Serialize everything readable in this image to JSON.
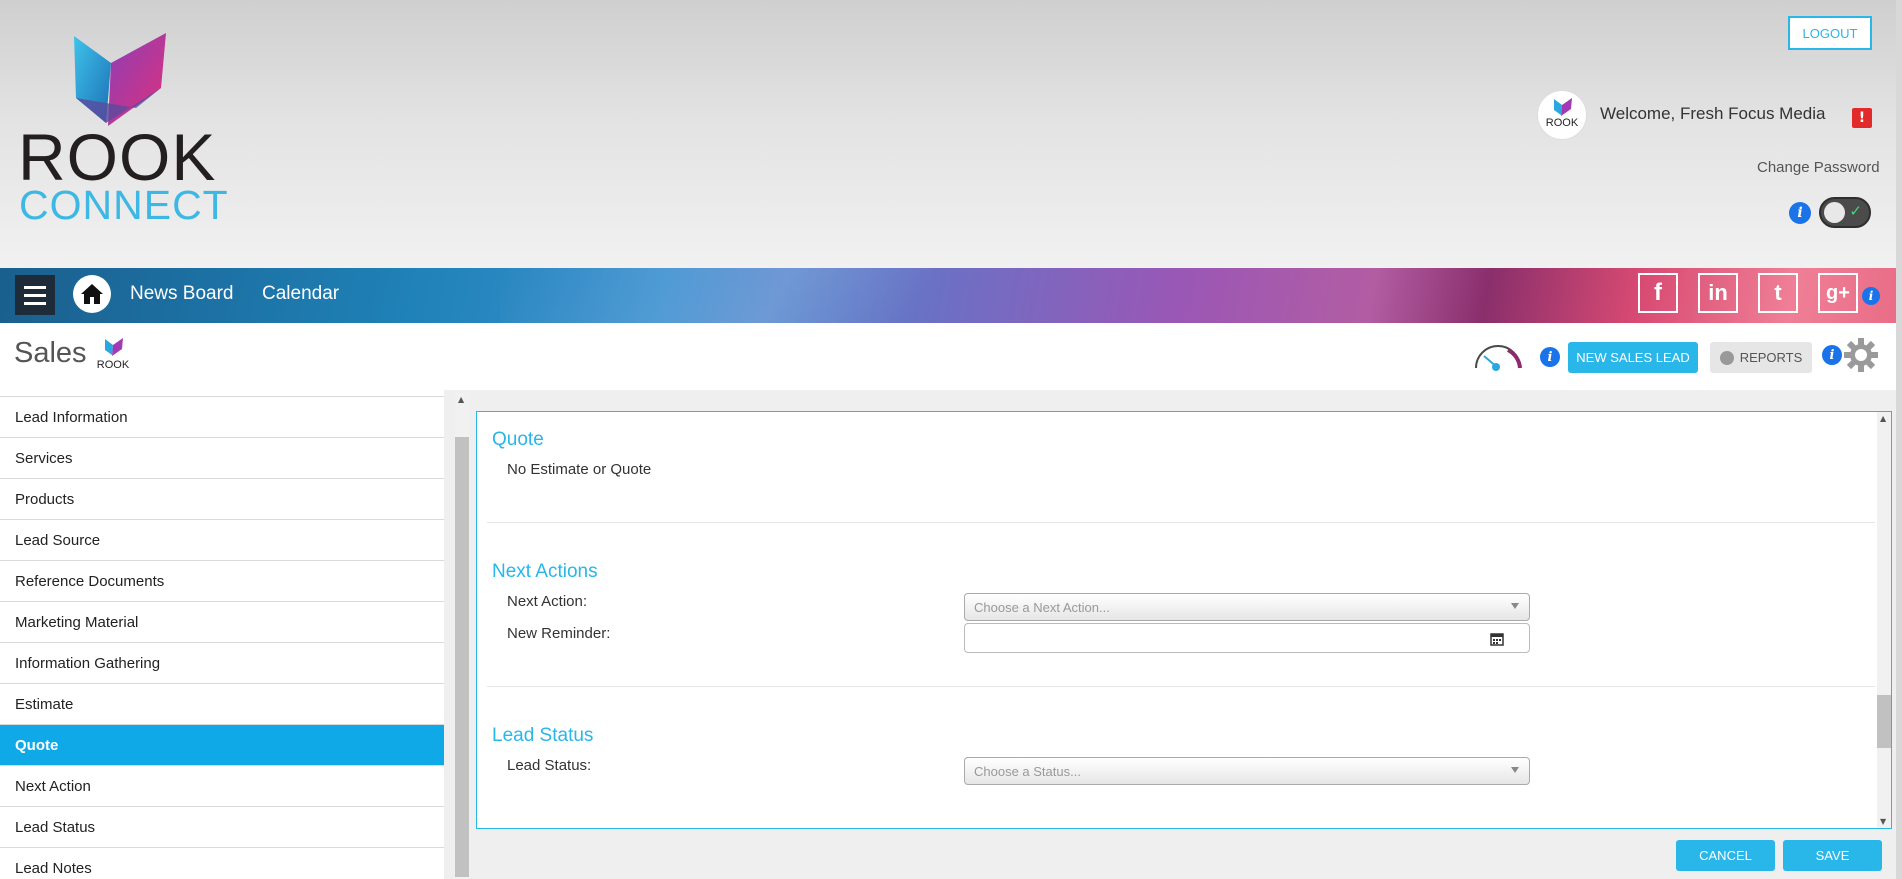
{
  "header": {
    "logo_line1": "ROOK",
    "logo_line2": "CONNECT",
    "logout_label": "LOGOUT",
    "welcome_text": "Welcome, Fresh Focus Media",
    "alert_badge": "!",
    "change_password": "Change Password",
    "info_glyph": "i"
  },
  "nav": {
    "links": [
      "News Board",
      "Calendar"
    ],
    "social": [
      "f",
      "in",
      "t",
      "g+"
    ]
  },
  "page": {
    "title": "Sales",
    "new_sales_lead": "NEW SALES LEAD",
    "reports": "REPORTS"
  },
  "sidebar": {
    "items": [
      {
        "label": "Lead Information"
      },
      {
        "label": "Services"
      },
      {
        "label": "Products"
      },
      {
        "label": "Lead Source"
      },
      {
        "label": "Reference Documents"
      },
      {
        "label": "Marketing Material"
      },
      {
        "label": "Information Gathering"
      },
      {
        "label": "Estimate"
      },
      {
        "label": "Quote"
      },
      {
        "label": "Next Action"
      },
      {
        "label": "Lead Status"
      },
      {
        "label": "Lead Notes"
      }
    ],
    "active_item": "Quote"
  },
  "main": {
    "quote": {
      "title": "Quote",
      "text": "No Estimate or Quote"
    },
    "next_actions": {
      "title": "Next Actions",
      "next_action_label": "Next Action:",
      "next_action_placeholder": "Choose a Next Action...",
      "reminder_label": "New Reminder:",
      "reminder_value": ""
    },
    "lead_status": {
      "title": "Lead Status",
      "status_label": "Lead Status:",
      "status_placeholder": "Choose a Status..."
    }
  },
  "footer": {
    "cancel": "CANCEL",
    "save": "SAVE"
  },
  "colors": {
    "accent": "#29b6e8",
    "sidebar_active": "#0fa9e8",
    "alert": "#e12a2a",
    "info": "#1a73e8"
  },
  "icons": [
    "home-icon",
    "menu-icon",
    "facebook-icon",
    "linkedin-icon",
    "twitter-icon",
    "google-plus-icon",
    "info-icon",
    "gauge-icon",
    "gear-icon",
    "calendar-icon",
    "pie-chart-icon",
    "alert-icon",
    "toggle-check-icon"
  ]
}
